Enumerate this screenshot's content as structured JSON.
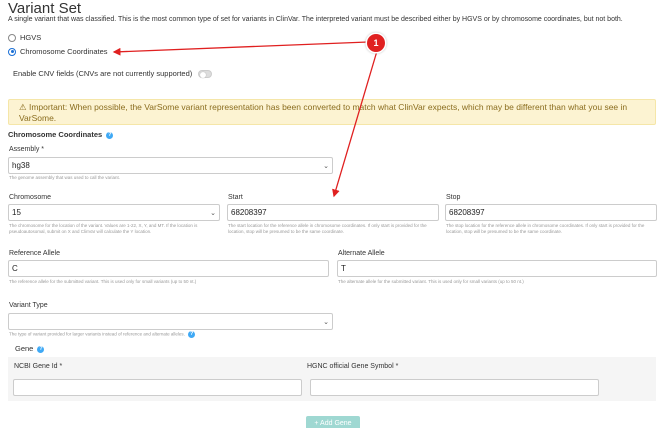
{
  "header": {
    "title": "Variant Set",
    "subtitle": "A single variant that was classified. This is the most common type of set for variants in ClinVar. The interpreted variant must be described either by HGVS or by chromosome coordinates, but not both."
  },
  "representation": {
    "options": [
      "HGVS",
      "Chromosome Coordinates"
    ],
    "selected": "Chromosome Coordinates"
  },
  "cnv_toggle": {
    "label": "Enable CNV fields (CNVs are not currently supported)",
    "on": false
  },
  "alert": {
    "text": "⚠ Important: When possible, the VarSome variant representation has been converted to match what ClinVar expects, which may be different than what you see in VarSome."
  },
  "coords": {
    "heading": "Chromosome Coordinates",
    "assembly": {
      "label": "Assembly",
      "required_mark": "*",
      "value": "hg38",
      "hint": "The genome assembly that was used to call the variant."
    },
    "chromosome": {
      "label": "Chromosome",
      "value": "15",
      "hint": "The chromosome for the location of the variant. Values are 1-22, X, Y, and MT. If the location is pseudoautosomal, submit on X and ClinVar will calculate the Y location."
    },
    "start": {
      "label": "Start",
      "value": "68208397",
      "hint": "The start location for the reference allele in chromosome coordinates. If only start is provided for the location, stop will be presumed to be the same coordinate."
    },
    "stop": {
      "label": "Stop",
      "value": "68208397",
      "hint": "The stop location for the reference allele in chromosome coordinates. If only start is provided for the location, stop will be presumed to be the same coordinate."
    },
    "ref": {
      "label": "Reference Allele",
      "value": "C",
      "hint": "The reference allele for the submitted variant. This is used only for small variants (up to 50 nt.)"
    },
    "alt": {
      "label": "Alternate Allele",
      "value": "T",
      "hint": "The alternate allele for the submitted variant. This is used only for small variants (up to 50 nt.)"
    },
    "variant_type": {
      "label": "Variant Type",
      "value": "",
      "hint": "The type of variant provided for larger variants instead of reference and alternate alleles."
    }
  },
  "gene": {
    "heading": "Gene",
    "ncbi_label": "NCBI Gene Id",
    "hgnc_label": "HGNC official Gene Symbol",
    "required_mark": "*",
    "ncbi_value": "",
    "hgnc_value": "",
    "add_button": "+ Add Gene"
  },
  "annotation": {
    "marker_number": "1",
    "color": "#e02020"
  }
}
